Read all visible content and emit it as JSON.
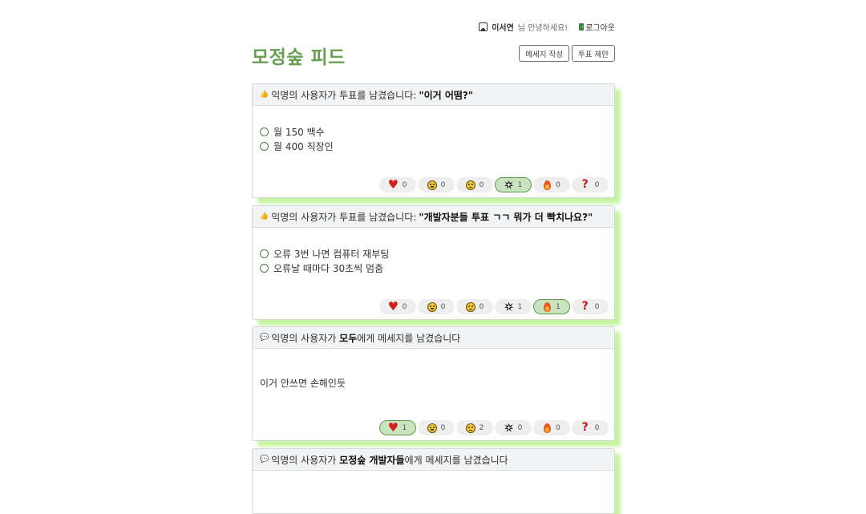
{
  "header": {
    "username": "이서연",
    "greeting": "님 안녕하세요!",
    "logout_label": "로그아웃",
    "page_title": "모정숲 피드",
    "write_message_label": "메세지 작성",
    "propose_vote_label": "투표 제안"
  },
  "reaction_icons": [
    "heart-icon",
    "laughing-face-icon",
    "sad-face-icon",
    "explosion-icon",
    "fire-icon",
    "question-mark-icon"
  ],
  "colors": {
    "title_green": "#6a9e4f",
    "card_shadow": "#c6f5a0",
    "active_reaction_bg": "#c9e3bf",
    "active_reaction_border": "#5a9a4a"
  },
  "feed": [
    {
      "type": "vote",
      "header_prefix": "익명의 사용자가 투표를 남겼습니다:",
      "question": "\"이거 어떰?\"",
      "options": [
        "월 150 백수",
        "월 400 직장인"
      ],
      "reactions": [
        {
          "icon": "heart-icon",
          "count": "0",
          "active": false
        },
        {
          "icon": "laughing-face-icon",
          "count": "0",
          "active": false
        },
        {
          "icon": "sad-face-icon",
          "count": "0",
          "active": false
        },
        {
          "icon": "explosion-icon",
          "count": "1",
          "active": true
        },
        {
          "icon": "fire-icon",
          "count": "0",
          "active": false
        },
        {
          "icon": "question-mark-icon",
          "count": "0",
          "active": false
        }
      ]
    },
    {
      "type": "vote",
      "header_prefix": "익명의 사용자가 투표를 남겼습니다:",
      "question": "\"개발자분들 투표 ㄱㄱ 뭐가 더 빡치나요?\"",
      "options": [
        "오류 3번 나면 컴퓨터 재부팅",
        "오류날 때마다 30초씩 멈춤"
      ],
      "reactions": [
        {
          "icon": "heart-icon",
          "count": "0",
          "active": false
        },
        {
          "icon": "laughing-face-icon",
          "count": "0",
          "active": false
        },
        {
          "icon": "sad-face-icon",
          "count": "0",
          "active": false
        },
        {
          "icon": "explosion-icon",
          "count": "1",
          "active": false
        },
        {
          "icon": "fire-icon",
          "count": "1",
          "active": true
        },
        {
          "icon": "question-mark-icon",
          "count": "0",
          "active": false
        }
      ]
    },
    {
      "type": "message",
      "header_prefix": "익명의 사용자가",
      "recipient": "모두",
      "header_suffix": "에게 메세지를 남겼습니다",
      "body": "이거 안쓰면 손해인듯",
      "reactions": [
        {
          "icon": "heart-icon",
          "count": "1",
          "active": true
        },
        {
          "icon": "laughing-face-icon",
          "count": "0",
          "active": false
        },
        {
          "icon": "sad-face-icon",
          "count": "2",
          "active": false
        },
        {
          "icon": "explosion-icon",
          "count": "0",
          "active": false
        },
        {
          "icon": "fire-icon",
          "count": "0",
          "active": false
        },
        {
          "icon": "question-mark-icon",
          "count": "0",
          "active": false
        }
      ]
    },
    {
      "type": "message",
      "header_prefix": "익명의 사용자가",
      "recipient": "모정숲 개발자들",
      "header_suffix": "에게 메세지를 남겼습니다"
    }
  ]
}
